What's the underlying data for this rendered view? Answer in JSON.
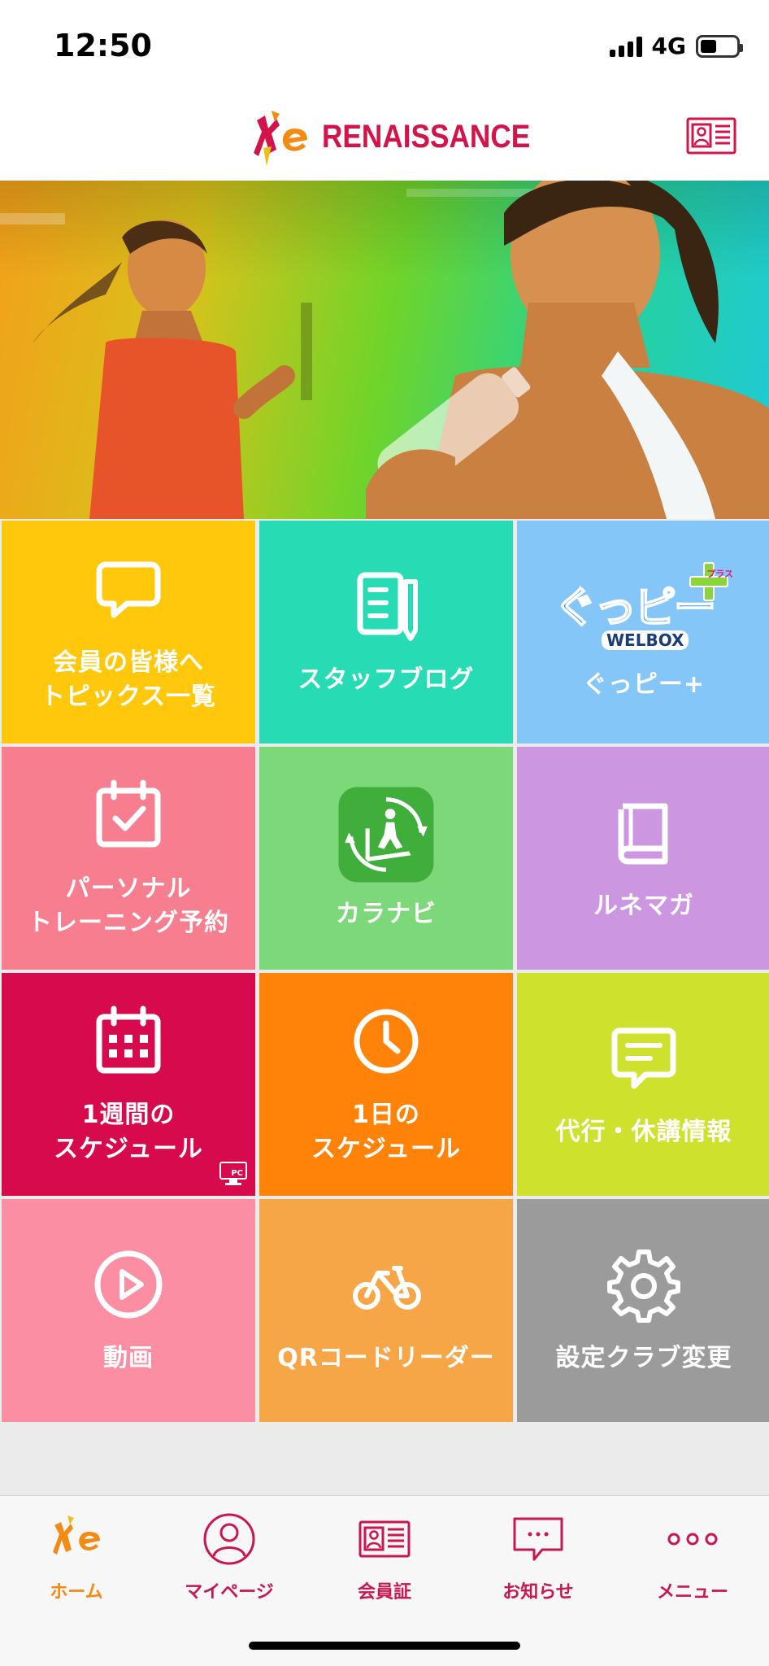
{
  "status_bar": {
    "time": "12:50",
    "network": "4G",
    "battery_level": 0.45
  },
  "header": {
    "brand": "RENAISSANCE",
    "card_icon": "member-card-icon"
  },
  "hero": {
    "icon": "fitness-photo"
  },
  "tiles": [
    {
      "label": "会員の皆様へ\nトピックス一覧",
      "icon": "speech-bubble-icon",
      "color": "#ffc80a"
    },
    {
      "label": "スタッフブログ",
      "icon": "notepad-pen-icon",
      "color": "#27dbb5"
    },
    {
      "label": "ぐっピー+",
      "logo": "ぐっピー",
      "logo_sub": "WELBOX",
      "logo_plus": "プラス",
      "icon": "goopy-logo",
      "color": "#85c6f8"
    },
    {
      "label": "パーソナル\nトレーニング予約",
      "icon": "calendar-check-icon",
      "color": "#f77e8f"
    },
    {
      "label": "カラナビ",
      "icon": "treadmill-app-icon",
      "color": "#7dd87a"
    },
    {
      "label": "ルネマガ",
      "icon": "book-icon",
      "color": "#cd96e0"
    },
    {
      "label": "1週間の\nスケジュール",
      "icon": "calendar-grid-icon",
      "color": "#d60a4c",
      "badge": "PC"
    },
    {
      "label": "1日の\nスケジュール",
      "icon": "clock-icon",
      "color": "#ff8308"
    },
    {
      "label": "代行・休講情報",
      "icon": "message-lines-icon",
      "color": "#cee22d"
    },
    {
      "label": "動画",
      "icon": "play-icon",
      "color": "#fc8ea4"
    },
    {
      "label": "QRコードリーダー",
      "icon": "bicycle-icon",
      "color": "#f7a647"
    },
    {
      "label": "設定クラブ変更",
      "icon": "gear-icon",
      "color": "#9b9b9b"
    }
  ],
  "tab_bar": {
    "items": [
      {
        "label": "ホーム",
        "icon": "home-logo-icon",
        "active": true
      },
      {
        "label": "マイページ",
        "icon": "person-icon",
        "active": false
      },
      {
        "label": "会員証",
        "icon": "member-card-icon",
        "active": false
      },
      {
        "label": "お知らせ",
        "icon": "notification-bubble-icon",
        "active": false
      },
      {
        "label": "メニュー",
        "icon": "more-dots-icon",
        "active": false
      }
    ],
    "accent": "#c8174e",
    "active_color": "#f28a14"
  }
}
